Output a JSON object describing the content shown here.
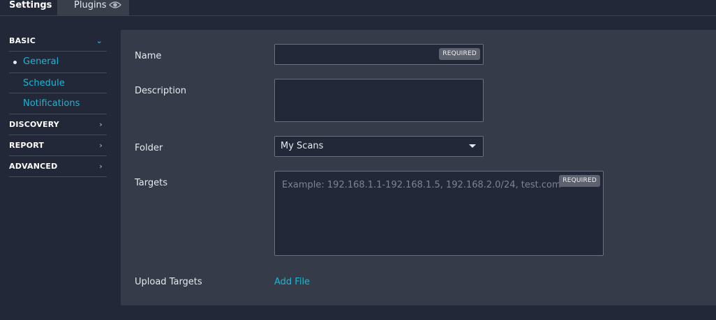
{
  "tabs": {
    "settings": "Settings",
    "plugins": "Plugins"
  },
  "sidebar": {
    "basic": "BASIC",
    "items": [
      "General",
      "Schedule",
      "Notifications"
    ],
    "discovery": "DISCOVERY",
    "report": "REPORT",
    "advanced": "ADVANCED"
  },
  "form": {
    "name_label": "Name",
    "required": "REQUIRED",
    "description_label": "Description",
    "folder_label": "Folder",
    "folder_value": "My Scans",
    "targets_label": "Targets",
    "targets_placeholder": "Example: 192.168.1.1-192.168.1.5, 192.168.2.0/24, test.com",
    "upload_label": "Upload Targets",
    "add_file": "Add File"
  },
  "colors": {
    "accent": "#1bb6d6",
    "background": "#232838",
    "panel": "#353b48"
  },
  "icons": {
    "plugins_tab": "eye-icon",
    "basic_toggle": "chevron-down-icon",
    "section_toggle": "chevron-right-icon",
    "folder_caret": "caret-down-icon"
  }
}
